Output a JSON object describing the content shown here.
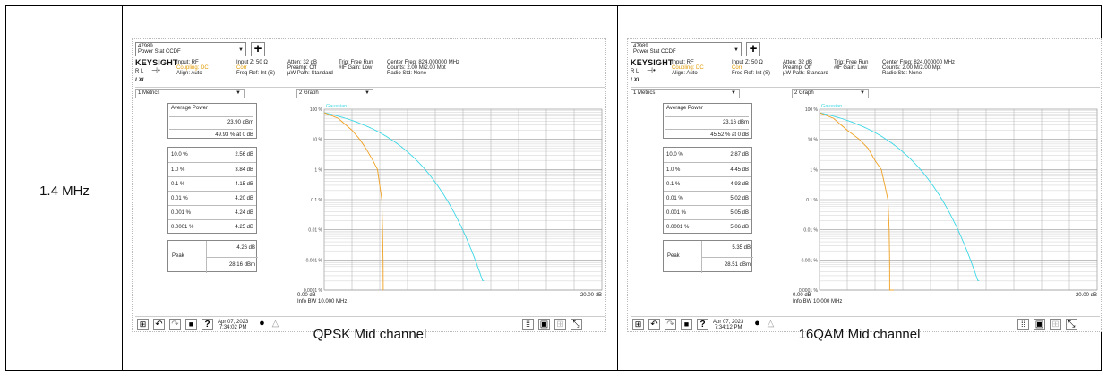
{
  "row_label": "1.4 MHz",
  "panels": [
    {
      "caption": "QPSK Mid channel",
      "screen": {
        "title_line1": "47989",
        "title_line2": "Power Stat CCDF",
        "brand": "KEYSIGHT",
        "rl": "R L",
        "lxi": "LXI",
        "input": "Input: RF",
        "coupling": "Coupling: DC",
        "align": "Align: Auto",
        "input_z": "Input Z: 50 Ω",
        "corr": "Corr",
        "freq_ref": "Freq Ref: Int (S)",
        "atten": "Atten: 32 dB",
        "preamp": "Preamp: Off",
        "uw_path": "µW Path: Standard",
        "trig": "Trig: Free Run",
        "if_gain": "#IF Gain: Low",
        "center_freq": "Center Freq: 824.000000 MHz",
        "counts": "Counts: 2.00 M/2.00 Mpt",
        "radio_std": "Radio Std: None",
        "metrics_dd": "1 Metrics",
        "graph_dd": "2 Graph",
        "avg_power_label": "Average Power",
        "avg_power_dbm": "23.90 dBm",
        "avg_power_pct": "49.93 % at 0 dB",
        "rows": [
          {
            "p": "10.0 %",
            "v": "2.56 dB"
          },
          {
            "p": "1.0 %",
            "v": "3.84 dB"
          },
          {
            "p": "0.1 %",
            "v": "4.15 dB"
          },
          {
            "p": "0.01 %",
            "v": "4.20 dB"
          },
          {
            "p": "0.001 %",
            "v": "4.24 dB"
          },
          {
            "p": "0.0001 %",
            "v": "4.25 dB"
          }
        ],
        "peak_label": "Peak",
        "peak_db": "4.26 dB",
        "peak_dbm": "28.16 dBm",
        "gaussian": "Gaussian",
        "y_ticks": [
          "100 %",
          "10 %",
          "1 %",
          "0.1 %",
          "0.01 %",
          "0.001 %",
          "0.0001 %"
        ],
        "x_left": "0.00 dB",
        "x_right": "20.00 dB",
        "info_bw": "Info BW 10.000 MHz",
        "date": "Apr 07, 2023",
        "time": "7:34:02 PM",
        "curve_db": [
          0,
          1,
          2,
          2.56,
          3,
          3.5,
          3.84,
          4.0,
          4.15,
          4.2,
          4.24,
          4.25,
          4.26
        ]
      }
    },
    {
      "caption": "16QAM Mid channel",
      "screen": {
        "title_line1": "47989",
        "title_line2": "Power Stat CCDF",
        "brand": "KEYSIGHT",
        "rl": "R L",
        "lxi": "LXI",
        "input": "Input: RF",
        "coupling": "Coupling: DC",
        "align": "Align: Auto",
        "input_z": "Input Z: 50 Ω",
        "corr": "Corr",
        "freq_ref": "Freq Ref: Int (S)",
        "atten": "Atten: 32 dB",
        "preamp": "Preamp: Off",
        "uw_path": "µW Path: Standard",
        "trig": "Trig: Free Run",
        "if_gain": "#IF Gain: Low",
        "center_freq": "Center Freq: 824.000000 MHz",
        "counts": "Counts: 2.00 M/2.00 Mpt",
        "radio_std": "Radio Std: None",
        "metrics_dd": "1 Metrics",
        "graph_dd": "2 Graph",
        "avg_power_label": "Average Power",
        "avg_power_dbm": "23.16 dBm",
        "avg_power_pct": "45.52 % at 0 dB",
        "rows": [
          {
            "p": "10.0 %",
            "v": "2.87 dB"
          },
          {
            "p": "1.0 %",
            "v": "4.45 dB"
          },
          {
            "p": "0.1 %",
            "v": "4.93 dB"
          },
          {
            "p": "0.01 %",
            "v": "5.02 dB"
          },
          {
            "p": "0.001 %",
            "v": "5.05 dB"
          },
          {
            "p": "0.0001 %",
            "v": "5.06 dB"
          }
        ],
        "peak_label": "Peak",
        "peak_db": "5.35 dB",
        "peak_dbm": "28.51 dBm",
        "gaussian": "Gaussian",
        "y_ticks": [
          "100 %",
          "10 %",
          "1 %",
          "0.1 %",
          "0.01 %",
          "0.001 %",
          "0.0001 %"
        ],
        "x_left": "0.00 dB",
        "x_right": "20.00 dB",
        "info_bw": "Info BW 10.000 MHz",
        "date": "Apr 07, 2023",
        "time": "7:34:12 PM",
        "curve_db": [
          0,
          1,
          2,
          2.87,
          3.5,
          4.0,
          4.45,
          4.7,
          4.93,
          5.02,
          5.05,
          5.06,
          5.35
        ]
      }
    }
  ],
  "colors": {
    "gaussian": "#3ad7e6",
    "measured": "#f0a020",
    "grid": "#bbbbbb"
  }
}
